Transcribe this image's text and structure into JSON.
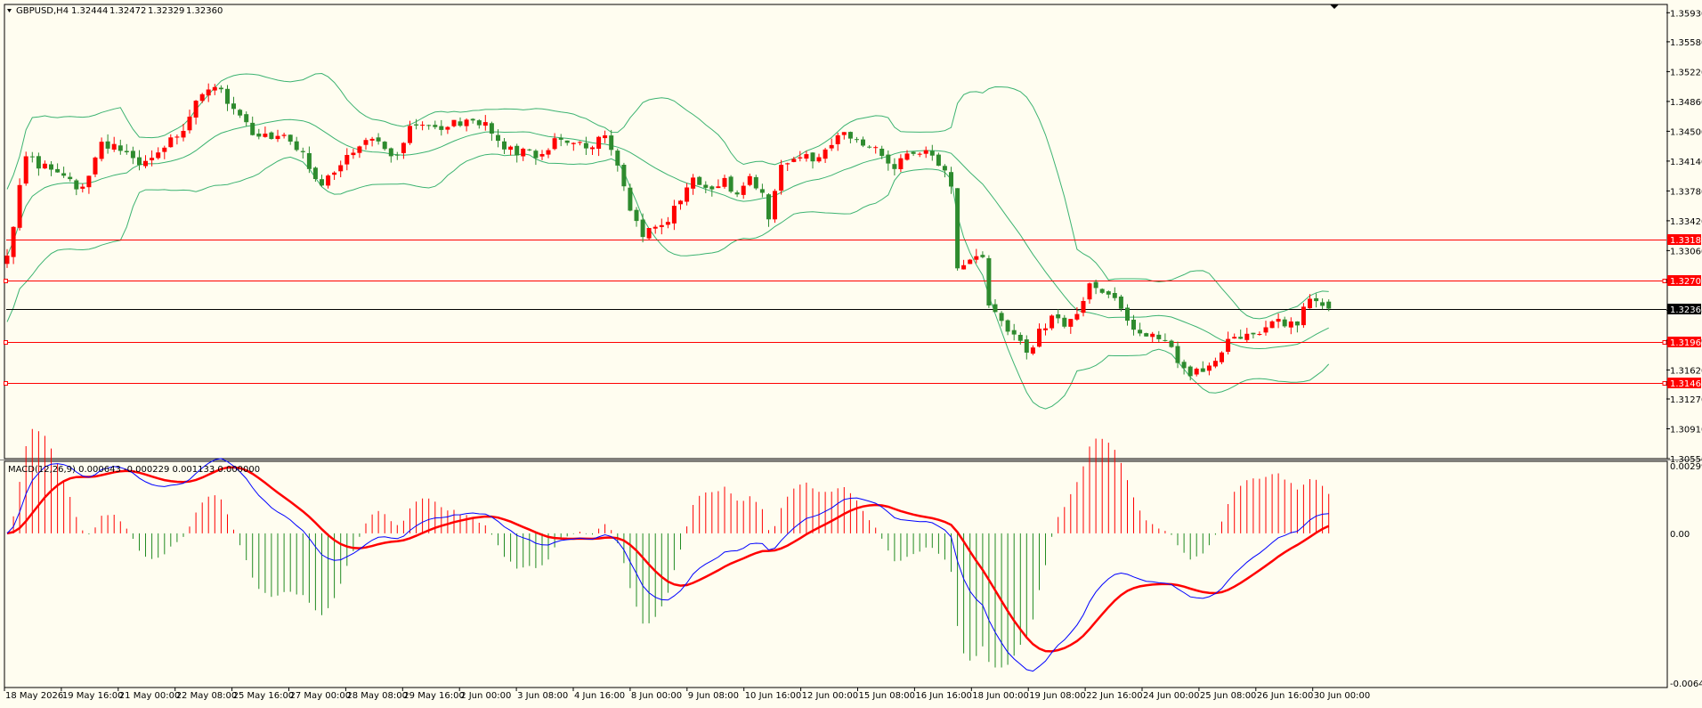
{
  "chart_data": {
    "type": "candlestick",
    "symbol_label": "GBPUSD,H4",
    "ohlc_readout": [
      "1.32444",
      "1.32472",
      "1.32329",
      "1.32360"
    ],
    "colors": {
      "background": "#FFFDF0",
      "up_candle": "#FF0000",
      "down_candle": "#2E8B2E",
      "bands": "#3CB371",
      "level_lines": "#FF0000",
      "price_line": "#000000",
      "macd_line": "#0000FF",
      "signal_line": "#FF0000",
      "hist_positive": "#FF0000",
      "hist_negative": "#228B22"
    },
    "price_axis": {
      "ylim": [
        1.3055,
        1.3603
      ],
      "ticks": [
        "1.35930",
        "1.35580",
        "1.35220",
        "1.34860",
        "1.34500",
        "1.34140",
        "1.33780",
        "1.33420",
        "1.33060",
        "1.32700",
        "1.32340",
        "1.31980",
        "1.31620",
        "1.31270",
        "1.30910",
        "1.30550"
      ]
    },
    "levels": [
      {
        "label": "1.33189",
        "value": 1.33189
      },
      {
        "label": "1.32700",
        "value": 1.327
      },
      {
        "label": "1.31961",
        "value": 1.31961
      },
      {
        "label": "1.31464",
        "value": 1.31464
      }
    ],
    "current_price": {
      "label": "1.32360",
      "value": 1.3236
    },
    "x_axis_labels": [
      "18 May 2026",
      "19 May 16:00",
      "21 May 00:00",
      "22 May 08:00",
      "25 May 16:00",
      "27 May 00:00",
      "28 May 08:00",
      "29 May 16:00",
      "2 Jun 00:00",
      "3 Jun 08:00",
      "4 Jun 16:00",
      "8 Jun 00:00",
      "9 Jun 08:00",
      "10 Jun 16:00",
      "12 Jun 00:00",
      "15 Jun 08:00",
      "16 Jun 16:00",
      "18 Jun 00:00",
      "19 Jun 08:00",
      "22 Jun 16:00",
      "24 Jun 00:00",
      "25 Jun 08:00",
      "26 Jun 16:00",
      "30 Jun 00:00"
    ],
    "close_anchors": [
      [
        0,
        1.33
      ],
      [
        3,
        1.342
      ],
      [
        8,
        1.3395
      ],
      [
        12,
        1.338
      ],
      [
        15,
        1.344
      ],
      [
        18,
        1.3425
      ],
      [
        21,
        1.341
      ],
      [
        24,
        1.342
      ],
      [
        28,
        1.3455
      ],
      [
        30,
        1.349
      ],
      [
        33,
        1.3505
      ],
      [
        36,
        1.348
      ],
      [
        38,
        1.346
      ],
      [
        40,
        1.344
      ],
      [
        44,
        1.3445
      ],
      [
        47,
        1.342
      ],
      [
        50,
        1.3385
      ],
      [
        53,
        1.341
      ],
      [
        57,
        1.344
      ],
      [
        60,
        1.343
      ],
      [
        62,
        1.342
      ],
      [
        64,
        1.3455
      ],
      [
        67,
        1.346
      ],
      [
        70,
        1.3455
      ],
      [
        73,
        1.3465
      ],
      [
        76,
        1.346
      ],
      [
        79,
        1.343
      ],
      [
        82,
        1.3425
      ],
      [
        85,
        1.342
      ],
      [
        88,
        1.3445
      ],
      [
        90,
        1.343
      ],
      [
        93,
        1.3435
      ],
      [
        95,
        1.344
      ],
      [
        97,
        1.3405
      ],
      [
        99,
        1.3355
      ],
      [
        101,
        1.3325
      ],
      [
        103,
        1.3335
      ],
      [
        105,
        1.3345
      ],
      [
        107,
        1.3365
      ],
      [
        109,
        1.3395
      ],
      [
        111,
        1.338
      ],
      [
        114,
        1.339
      ],
      [
        116,
        1.337
      ],
      [
        118,
        1.339
      ],
      [
        120,
        1.3375
      ],
      [
        121,
        1.334
      ],
      [
        123,
        1.341
      ],
      [
        126,
        1.3415
      ],
      [
        129,
        1.342
      ],
      [
        132,
        1.3445
      ],
      [
        135,
        1.344
      ],
      [
        137,
        1.343
      ],
      [
        139,
        1.342
      ],
      [
        141,
        1.341
      ],
      [
        143,
        1.342
      ],
      [
        146,
        1.3425
      ],
      [
        147,
        1.342
      ],
      [
        149,
        1.3405
      ],
      [
        150,
        1.3385
      ],
      [
        151,
        1.328
      ],
      [
        153,
        1.33
      ],
      [
        155,
        1.3295
      ],
      [
        156,
        1.324
      ],
      [
        158,
        1.322
      ],
      [
        160,
        1.3205
      ],
      [
        162,
        1.318
      ],
      [
        164,
        1.321
      ],
      [
        166,
        1.3225
      ],
      [
        168,
        1.3215
      ],
      [
        170,
        1.3235
      ],
      [
        172,
        1.3265
      ],
      [
        174,
        1.325
      ],
      [
        176,
        1.3245
      ],
      [
        178,
        1.3225
      ],
      [
        180,
        1.3205
      ],
      [
        182,
        1.32
      ],
      [
        184,
        1.3195
      ],
      [
        186,
        1.3175
      ],
      [
        188,
        1.316
      ],
      [
        190,
        1.3165
      ],
      [
        192,
        1.3175
      ],
      [
        194,
        1.3195
      ],
      [
        196,
        1.32
      ],
      [
        198,
        1.3205
      ],
      [
        200,
        1.3215
      ],
      [
        202,
        1.3225
      ],
      [
        204,
        1.3215
      ],
      [
        205,
        1.321
      ],
      [
        206,
        1.324
      ],
      [
        207,
        1.3252
      ],
      [
        209,
        1.3245
      ],
      [
        210,
        1.3236
      ]
    ],
    "macd": {
      "label": "MACD(12,26,9) 0.000643 -0.000229 0.001133 0.000000",
      "ylim": [
        -0.00642,
        0.002998
      ],
      "ticks": [
        "0.002998",
        "0.00",
        "-0.00642"
      ]
    }
  }
}
